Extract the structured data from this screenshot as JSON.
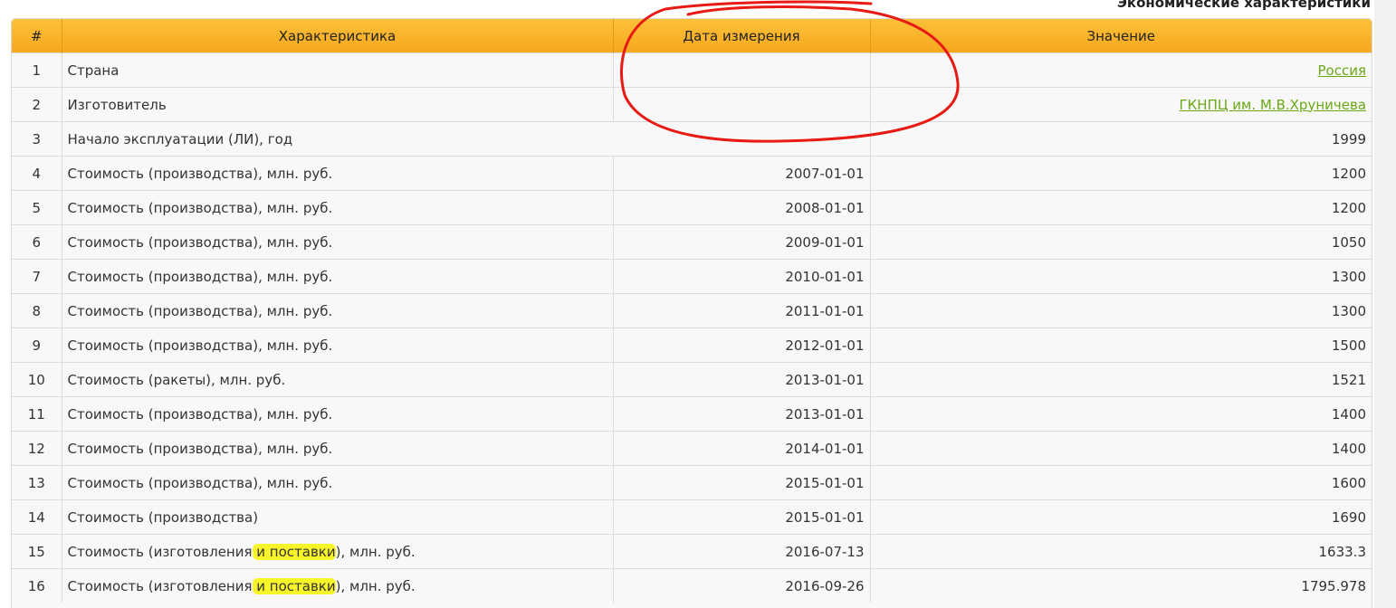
{
  "caption": "Экономические характеристики",
  "colors": {
    "header": "#f7a81d",
    "link": "#6aa816",
    "annotation": "#e81a14",
    "highlight": "#f7f42a"
  },
  "table": {
    "headers": [
      "#",
      "Характеристика",
      "Дата измерения",
      "Значение"
    ],
    "rows": [
      {
        "n": "1",
        "name": "Страна",
        "date": "",
        "value": "Россия",
        "link": true
      },
      {
        "n": "2",
        "name": "Изготовитель",
        "date": "",
        "value": "ГКНПЦ им. М.В.Хруничева",
        "link": true
      },
      {
        "n": "3",
        "name": "Начало эксплуатации (ЛИ), год",
        "date": "",
        "value": "1999",
        "merged": true
      },
      {
        "n": "4",
        "name": "Стоимость (производства), млн. руб.",
        "date": "2007-01-01",
        "value": "1200"
      },
      {
        "n": "5",
        "name": "Стоимость (производства), млн. руб.",
        "date": "2008-01-01",
        "value": "1200"
      },
      {
        "n": "6",
        "name": "Стоимость (производства), млн. руб.",
        "date": "2009-01-01",
        "value": "1050"
      },
      {
        "n": "7",
        "name": "Стоимость (производства), млн. руб.",
        "date": "2010-01-01",
        "value": "1300"
      },
      {
        "n": "8",
        "name": "Стоимость (производства), млн. руб.",
        "date": "2011-01-01",
        "value": "1300"
      },
      {
        "n": "9",
        "name": "Стоимость (производства), млн. руб.",
        "date": "2012-01-01",
        "value": "1500"
      },
      {
        "n": "10",
        "name": "Стоимость (ракеты), млн. руб.",
        "date": "2013-01-01",
        "value": "1521"
      },
      {
        "n": "11",
        "name": "Стоимость (производства), млн. руб.",
        "date": "2013-01-01",
        "value": "1400"
      },
      {
        "n": "12",
        "name": "Стоимость (производства), млн. руб.",
        "date": "2014-01-01",
        "value": "1400"
      },
      {
        "n": "13",
        "name": "Стоимость (производства), млн. руб.",
        "date": "2015-01-01",
        "value": "1600"
      },
      {
        "n": "14",
        "name": "Стоимость (производства)",
        "date": "2015-01-01",
        "value": "1690"
      },
      {
        "n": "15",
        "name_parts": [
          "Стоимость (изготовления",
          " и поставки",
          "), млн. руб."
        ],
        "date": "2016-07-13",
        "value": "1633.3"
      },
      {
        "n": "16",
        "name_parts": [
          "Стоимость (изготовления",
          " и поставки",
          "), млн. руб."
        ],
        "date": "2016-09-26",
        "value": "1795.978"
      }
    ]
  }
}
